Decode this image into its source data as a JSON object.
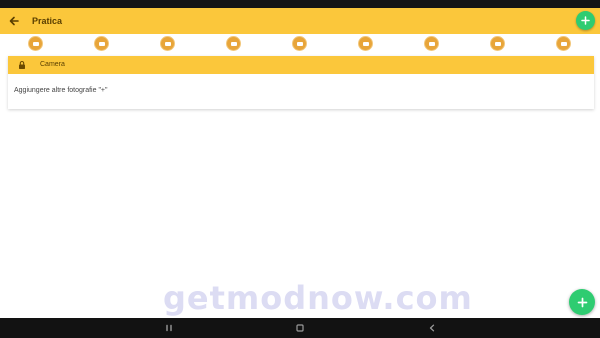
{
  "app_bar": {
    "title": "Pratica"
  },
  "steps": [
    {
      "icon": "step-icon"
    },
    {
      "icon": "step-icon"
    },
    {
      "icon": "step-icon"
    },
    {
      "icon": "step-icon"
    },
    {
      "icon": "step-icon"
    },
    {
      "icon": "step-icon"
    },
    {
      "icon": "step-icon"
    },
    {
      "icon": "step-icon"
    },
    {
      "icon": "step-icon"
    }
  ],
  "card": {
    "header_title": "Camera",
    "body_text": "Aggiungere altre fotografie \"+\""
  },
  "watermark": {
    "text": "getmodnow.com"
  },
  "colors": {
    "accent": "#fbc73b",
    "fab": "#2ecc71",
    "step": "#e8a53a",
    "system_bar": "#121212"
  }
}
